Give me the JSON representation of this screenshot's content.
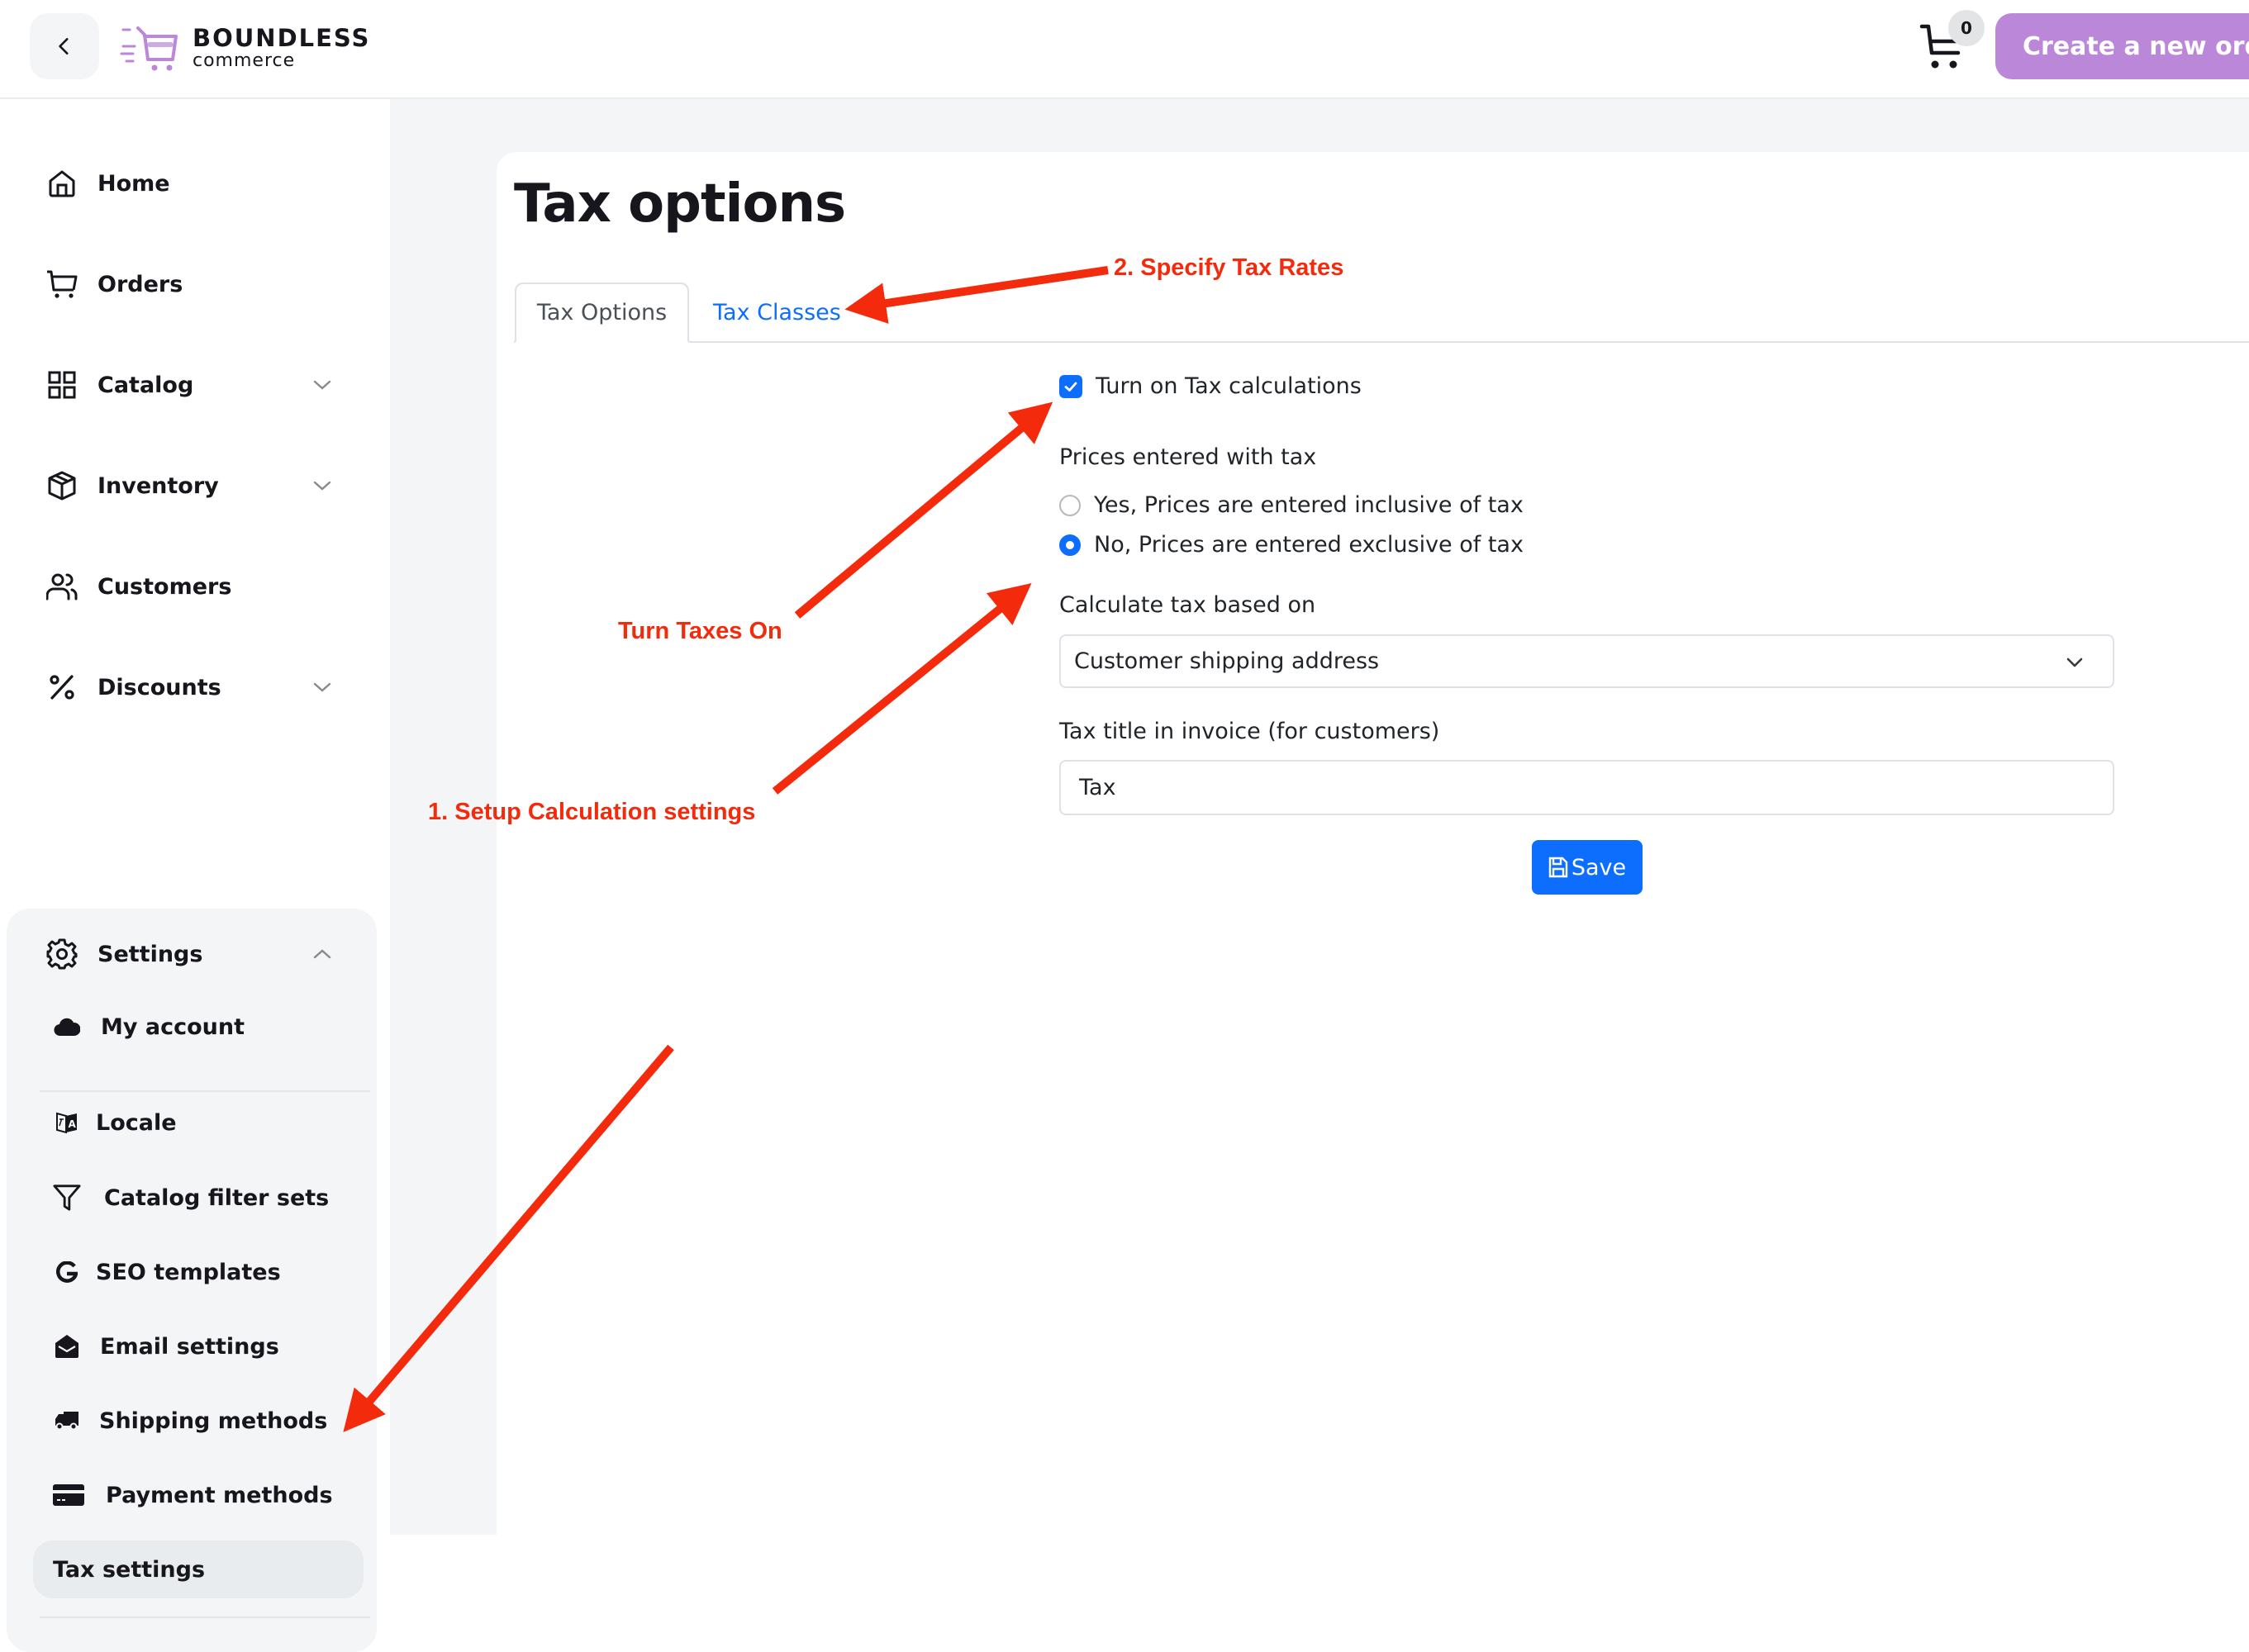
{
  "header": {
    "back_icon": "chevron-left-icon",
    "logo_title": "BOUNDLESS",
    "logo_subtitle": "commerce",
    "cart_icon": "cart-icon",
    "cart_count": "0",
    "create_order_label": "Create a new order",
    "brand_color": "#bb87d9"
  },
  "sidebar": {
    "items": [
      {
        "label": "Home",
        "icon": "home-icon",
        "expandable": false
      },
      {
        "label": "Orders",
        "icon": "cart-icon",
        "expandable": false
      },
      {
        "label": "Catalog",
        "icon": "grid-icon",
        "expandable": true
      },
      {
        "label": "Inventory",
        "icon": "box-icon",
        "expandable": true
      },
      {
        "label": "Customers",
        "icon": "users-icon",
        "expandable": true
      },
      {
        "label": "Discounts",
        "icon": "percent-icon",
        "expandable": true
      }
    ],
    "settings": {
      "label": "Settings",
      "icon": "gear-icon",
      "expanded": true,
      "items": [
        {
          "label": "My account",
          "icon": "cloud-icon"
        },
        {
          "label": "Locale",
          "icon": "translate-icon"
        },
        {
          "label": "Catalog filter sets",
          "icon": "filter-icon"
        },
        {
          "label": "SEO templates",
          "icon": "google-icon"
        },
        {
          "label": "Email settings",
          "icon": "envelope-open-icon"
        },
        {
          "label": "Shipping methods",
          "icon": "truck-icon"
        },
        {
          "label": "Payment methods",
          "icon": "credit-card-icon"
        },
        {
          "label": "Tax settings",
          "icon": "",
          "active": true
        }
      ]
    }
  },
  "main": {
    "title": "Tax options",
    "tabs": [
      {
        "label": "Tax Options",
        "active": true
      },
      {
        "label": "Tax Classes",
        "active": false
      }
    ],
    "form": {
      "turn_on_label": "Turn on Tax calculations",
      "turn_on_checked": true,
      "prices_label": "Prices entered with tax",
      "radio_options": [
        {
          "label": "Yes, Prices are entered inclusive of tax",
          "checked": false
        },
        {
          "label": "No, Prices are entered exclusive of tax",
          "checked": true
        }
      ],
      "calc_based_label": "Calculate tax based on",
      "calc_based_value": "Customer shipping address",
      "tax_title_label": "Tax title in invoice (for customers)",
      "tax_title_value": "Tax",
      "save_label": "Save",
      "accent_color": "#0d6efd"
    }
  },
  "annotations": {
    "color": "#f32a0c",
    "specify_rates": "2. Specify Tax Rates",
    "turn_taxes_on": "Turn Taxes On",
    "setup_calc": "1. Setup Calculation settings"
  }
}
